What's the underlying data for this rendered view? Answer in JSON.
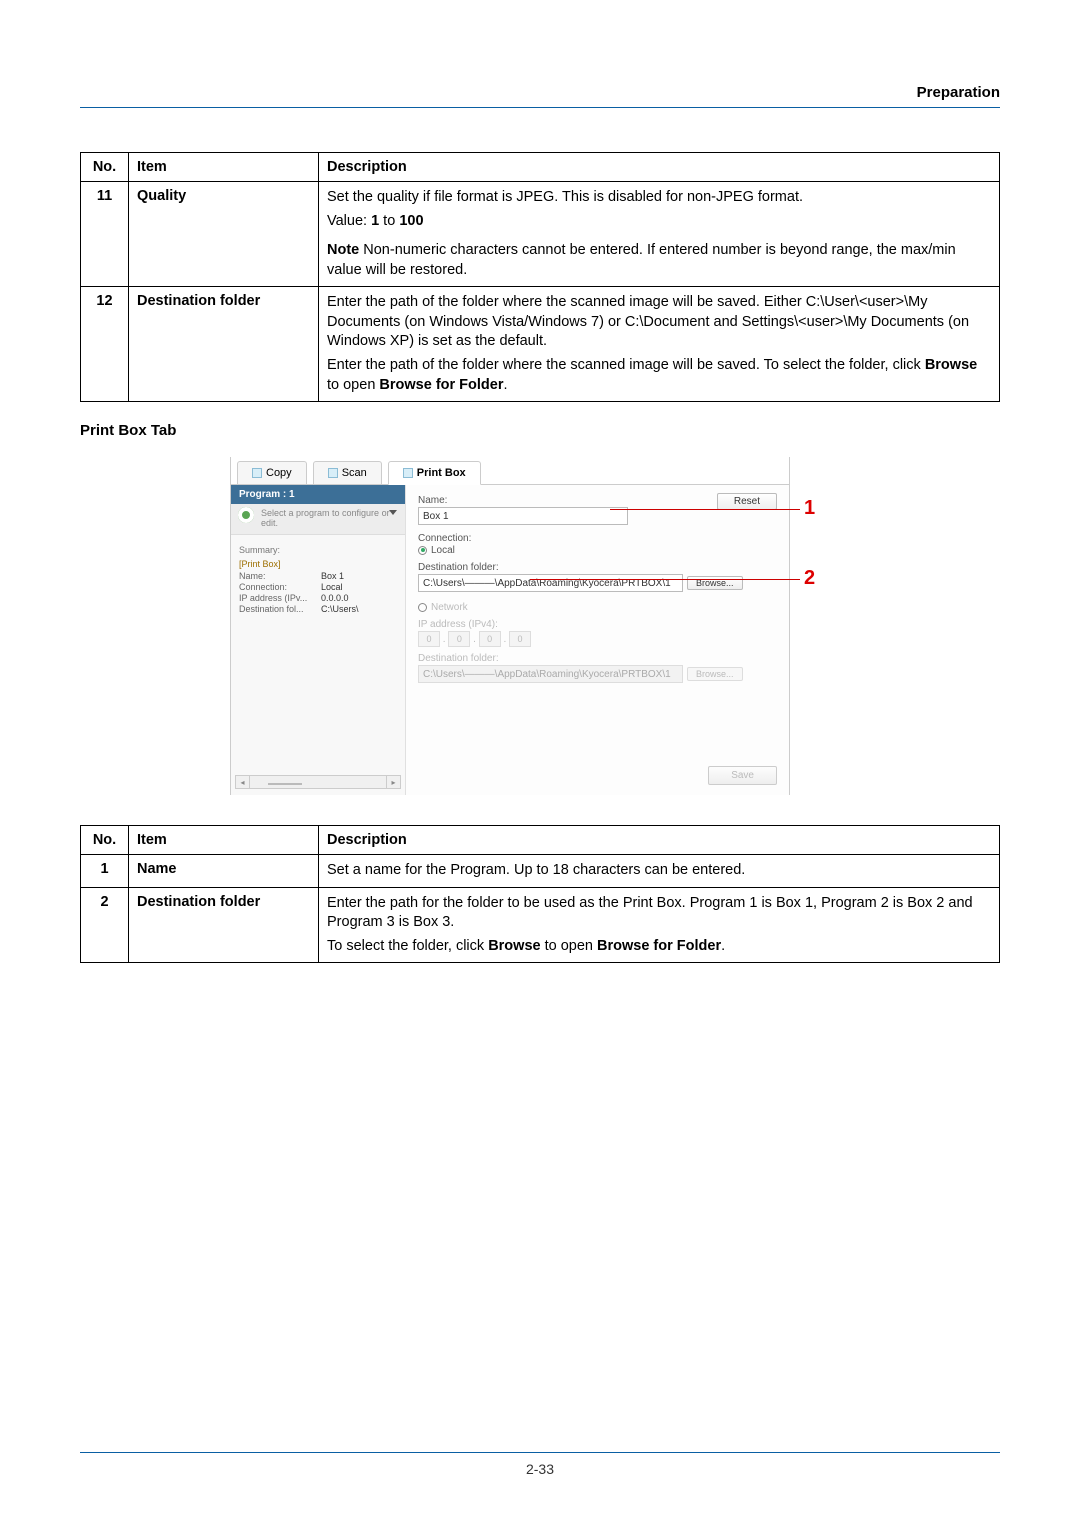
{
  "header": {
    "section": "Preparation"
  },
  "table1": {
    "headers": {
      "no": "No.",
      "item": "Item",
      "desc": "Description"
    },
    "rows": [
      {
        "no": "11",
        "item": "Quality",
        "desc_p1": "Set the quality if file format is JPEG. This is disabled for non-JPEG format.",
        "desc_p2_prefix": "Value: ",
        "desc_p2_b1": "1",
        "desc_p2_mid": " to ",
        "desc_p2_b2": "100",
        "note_label": "Note",
        "note_text": "  Non-numeric characters cannot be entered. If entered number is beyond range, the max/min value will be restored."
      },
      {
        "no": "12",
        "item": "Destination folder",
        "desc_p1": "Enter the path of the folder where the scanned image will be saved. Either C:\\User\\<user>\\My Documents (on Windows Vista/Windows 7) or C:\\Document and Settings\\<user>\\My Documents (on Windows XP) is set as the default.",
        "desc_p2_a": "Enter the path of the folder where the scanned image will be saved. To select the folder, click ",
        "desc_p2_b1": "Browse",
        "desc_p2_b": " to open ",
        "desc_p2_b2": "Browse for Folder",
        "desc_p2_c": "."
      }
    ]
  },
  "section_heading": "Print Box Tab",
  "screenshot": {
    "tabs": {
      "copy": "Copy",
      "scan": "Scan",
      "printbox": "Print Box"
    },
    "program": {
      "title": "Program : 1",
      "hint": "Select a program to configure or edit."
    },
    "summary": {
      "label": "Summary:",
      "category": "[Print Box]",
      "name_lbl": "Name:",
      "name_val": "Box 1",
      "conn_lbl": "Connection:",
      "conn_val": "Local",
      "ip_lbl": "IP address (IPv...",
      "ip_val": "0.0.0.0",
      "dest_lbl": "Destination fol...",
      "dest_val": "C:\\Users\\"
    },
    "right": {
      "reset": "Reset",
      "name_lbl": "Name:",
      "name_val": "Box 1",
      "conn_lbl": "Connection:",
      "local": "Local",
      "dest_lbl": "Destination folder:",
      "dest_val": "C:\\Users\\———\\AppData\\Roaming\\Kyocera\\PRTBOX\\1",
      "browse": "Browse...",
      "network": "Network",
      "ip_lbl": "IP address (IPv4):",
      "ip_oct": "0",
      "dest2_lbl": "Destination folder:",
      "dest2_val": "C:\\Users\\———\\AppData\\Roaming\\Kyocera\\PRTBOX\\1",
      "save": "Save"
    },
    "callouts": {
      "c1": "1",
      "c2": "2"
    }
  },
  "table2": {
    "headers": {
      "no": "No.",
      "item": "Item",
      "desc": "Description"
    },
    "rows": [
      {
        "no": "1",
        "item": "Name",
        "desc": "Set a name for the Program. Up to 18 characters can be entered."
      },
      {
        "no": "2",
        "item": "Destination folder",
        "desc_p1": "Enter the path for the folder to be used as the Print Box. Program 1 is Box 1, Program 2 is Box 2 and Program 3 is Box 3.",
        "desc_p2_a": "To select the folder, click ",
        "desc_p2_b1": "Browse",
        "desc_p2_b": " to open ",
        "desc_p2_b2": "Browse for Folder",
        "desc_p2_c": "."
      }
    ]
  },
  "footer": {
    "page": "2-33"
  }
}
